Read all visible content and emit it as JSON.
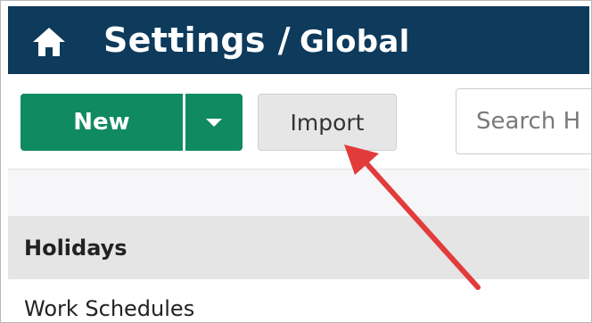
{
  "header": {
    "title": "Settings",
    "separator": "/",
    "subtitle": "Global",
    "home_icon": "home-icon"
  },
  "toolbar": {
    "new_label": "New",
    "new_dropdown_icon": "caret-down-icon",
    "import_label": "Import",
    "search_placeholder": "Search H"
  },
  "list": {
    "items": [
      {
        "label": "Holidays",
        "selected": true
      },
      {
        "label": "Work Schedules",
        "selected": false
      }
    ]
  },
  "colors": {
    "header_bg": "#0e3a5c",
    "primary_button": "#108a60",
    "annotation_arrow": "#e23b3b"
  }
}
